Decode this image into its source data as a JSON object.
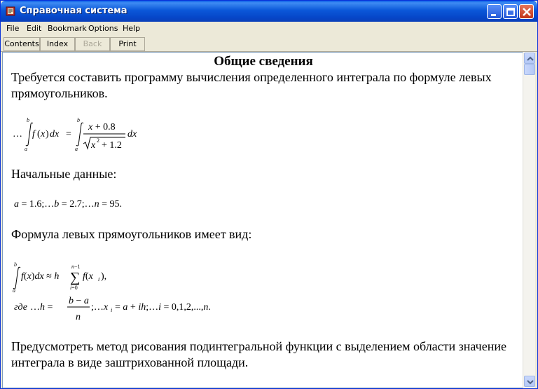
{
  "window": {
    "title": "Справочная система"
  },
  "menu": {
    "file": "File",
    "edit": "Edit",
    "bookmark": "Bookmark",
    "options": "Options",
    "help": "Help"
  },
  "toolbar": {
    "contents": "Contents",
    "index": "Index",
    "back": "Back",
    "print": "Print"
  },
  "document": {
    "heading": "Общие сведения",
    "intro": "Требуется составить программу вычисления определенного интеграла по формуле левых прямоугольников.",
    "initial_data_label": "Начальные данные:",
    "formula_label": "Формула левых прямоугольников имеет вид:",
    "conclusion": "Предусмотреть метод рисования подинтегральной функции с выделением области значение интеграла в виде заштрихованной  площади."
  },
  "icons": {
    "app": "help-book-icon",
    "minimize": "minimize-icon",
    "maximize": "maximize-icon",
    "close": "close-icon",
    "scroll_up": "arrow-up-icon",
    "scroll_down": "arrow-down-icon"
  },
  "colors": {
    "titlebar": "#0b58d9",
    "close_button": "#c2351a",
    "window_bg": "#ece9d8"
  }
}
